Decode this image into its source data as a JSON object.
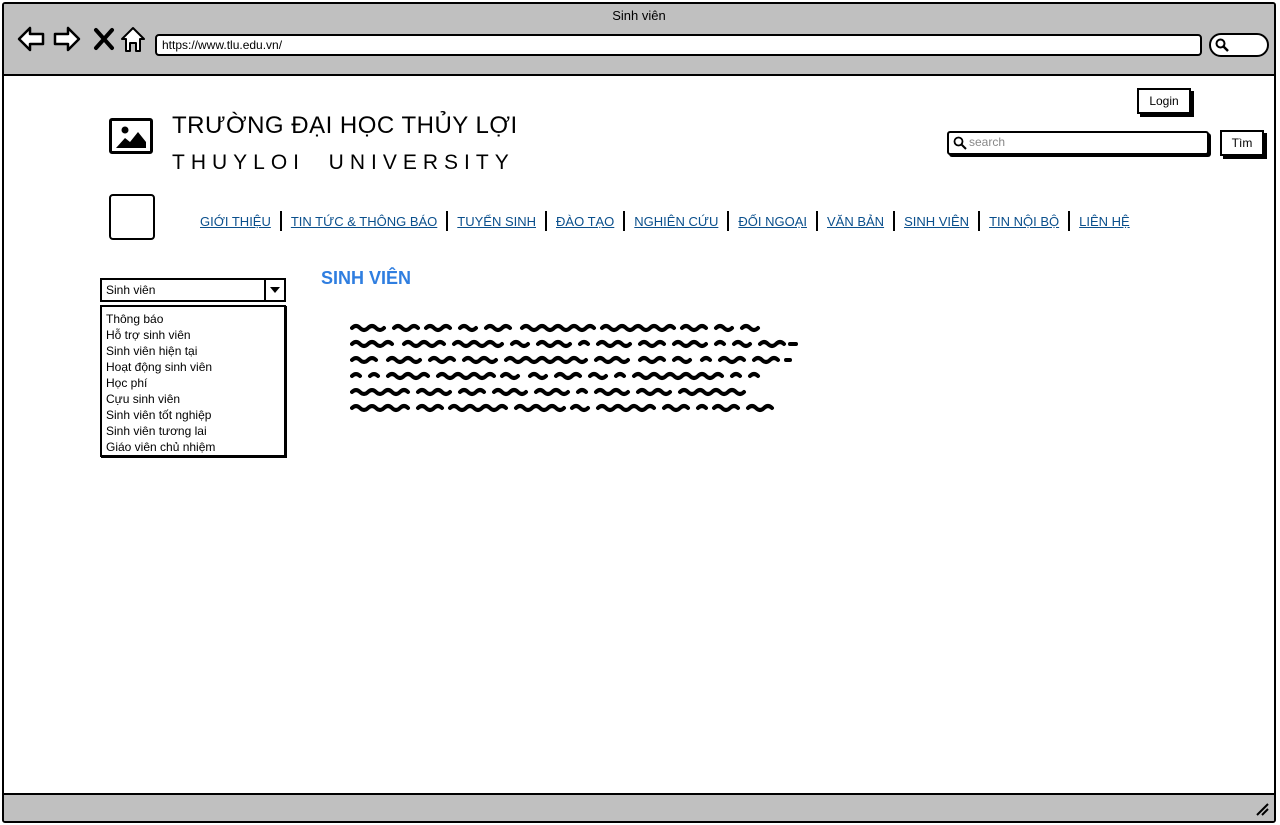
{
  "window": {
    "title": "Sinh viên"
  },
  "browser": {
    "url": "https://www.tlu.edu.vn/",
    "buttons": [
      "back",
      "forward",
      "stop",
      "home"
    ]
  },
  "header": {
    "name_vi": "TRƯỜNG ĐẠI HỌC THỦY LỢI",
    "name_en": "THUYLOI  UNIVERSITY",
    "login_label": "Login",
    "search_placeholder": "search",
    "search_button": "Tìm"
  },
  "nav": {
    "items": [
      "GIỚI THIỆU",
      "TIN TỨC & THÔNG BÁO",
      "TUYỂN SINH",
      "ĐÀO TẠO",
      "NGHIÊN CỨU",
      "ĐỐI NGOẠI",
      "VĂN BẢN",
      "SINH VIÊN",
      "TIN NỘI BỘ",
      "LIÊN HỆ"
    ],
    "link_color": "#0a4f8c"
  },
  "sidebar": {
    "selected": "Sinh viên",
    "options": [
      "Thông báo",
      "Hỗ trợ sinh viên",
      "Sinh viên hiện tại",
      "Hoạt động sinh viên",
      "Học phí",
      "Cựu sinh viên",
      "Sinh viên tốt nghiệp",
      "Sinh viên tương lai",
      "Giáo viên chủ nhiệm"
    ]
  },
  "main": {
    "heading": "SINH VIÊN",
    "heading_color": "#2f7ee0"
  }
}
